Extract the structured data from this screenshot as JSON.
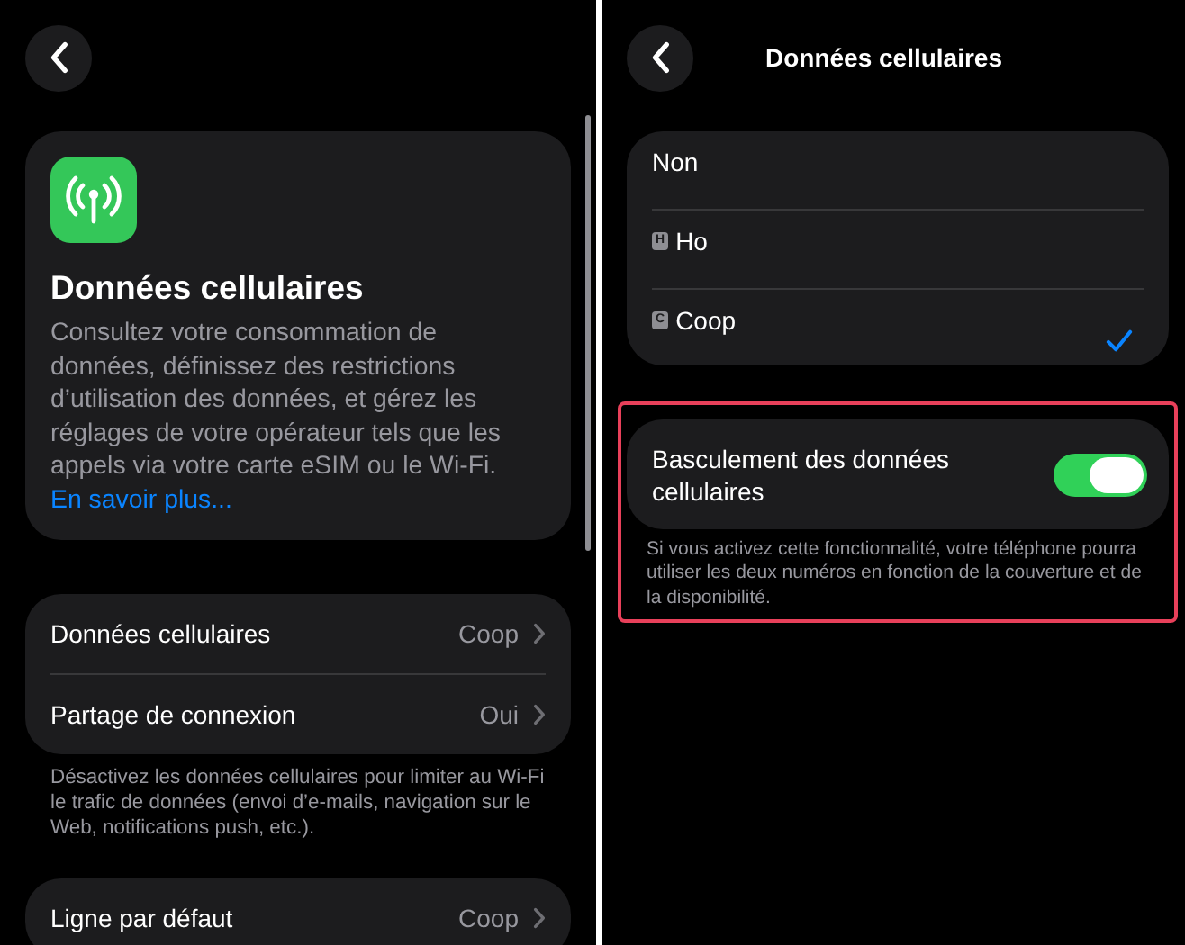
{
  "left_panel": {
    "header": {
      "title": "Données cellulaires",
      "description": "Consultez votre consommation de données, définissez des restrictions d’utilisation des données, et gérez les réglages de votre opérateur tels que les appels via votre carte eSIM ou le Wi-Fi.",
      "link": "En savoir plus..."
    },
    "groups": [
      {
        "rows": [
          {
            "label": "Données cellulaires",
            "value": "Coop"
          },
          {
            "label": "Partage de connexion",
            "value": "Oui"
          }
        ],
        "footnote": "Désactivez les données cellulaires pour limiter au Wi-Fi le trafic de données (envoi d’e-mails, navigation sur le Web, notifications push, etc.)."
      },
      {
        "rows": [
          {
            "label": "Ligne par défaut",
            "value": "Coop"
          }
        ]
      }
    ]
  },
  "right_panel": {
    "title": "Données cellulaires",
    "options": [
      {
        "label": "Non",
        "selected": false
      },
      {
        "badge": "H",
        "label": "Ho",
        "selected": false
      },
      {
        "badge": "C",
        "label": "Coop",
        "selected": true
      }
    ],
    "switch_section": {
      "highlighted": true,
      "label": "Basculement des données cellulaires",
      "on": true,
      "footnote": "Si vous activez cette fonctionnalité, votre téléphone pourra utiliser les deux numéros en fonction de la couverture et de la disponibilité."
    }
  }
}
